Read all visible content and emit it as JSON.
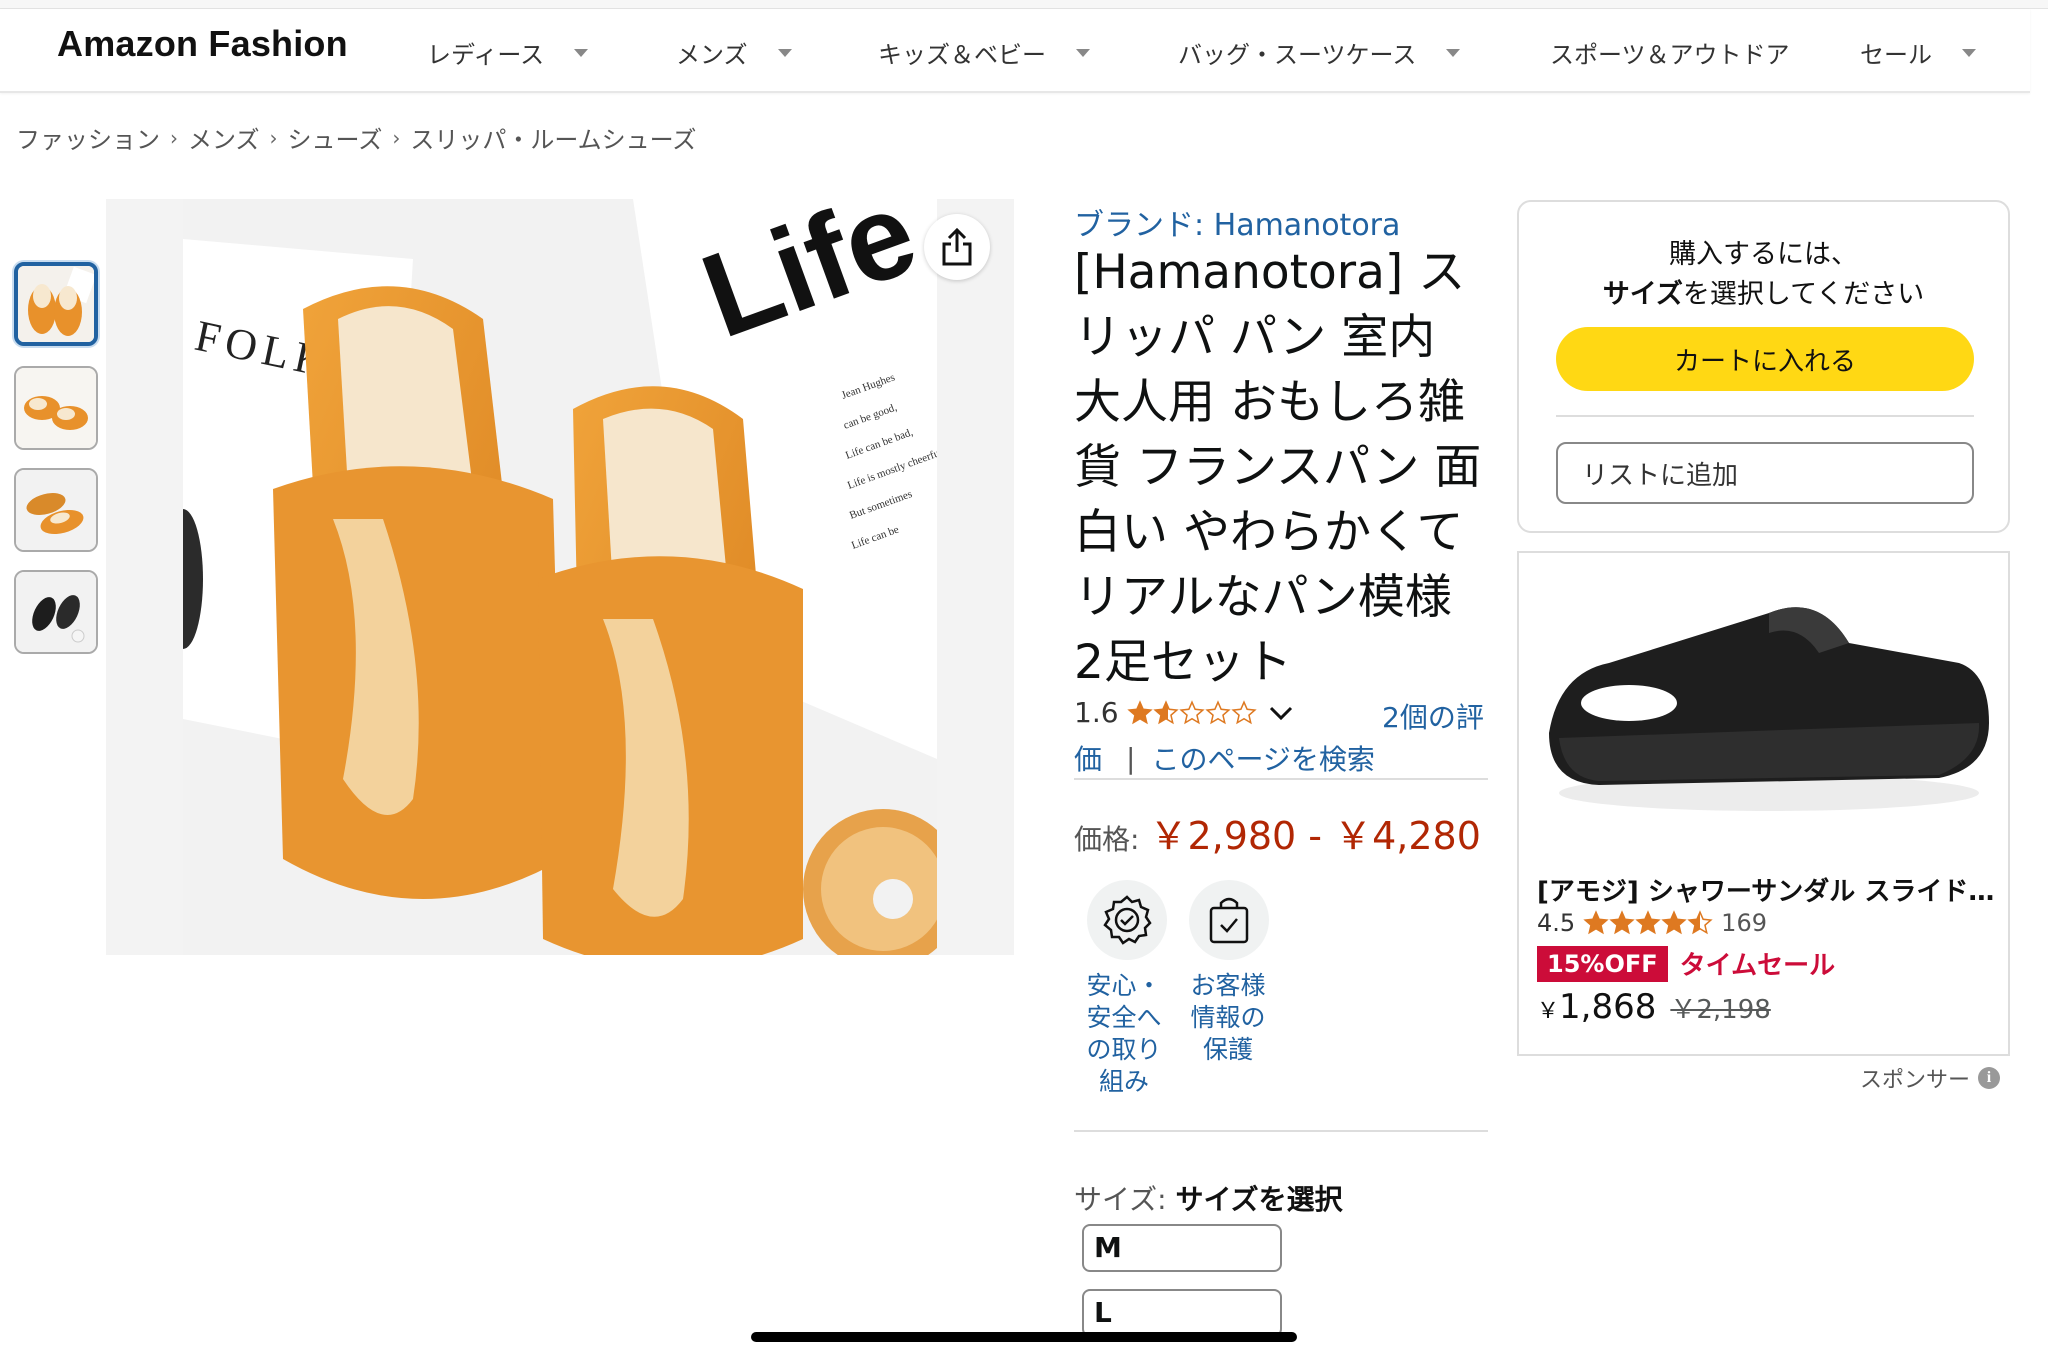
{
  "nav": {
    "logo": "Amazon Fashion",
    "items": [
      {
        "label": "レディース"
      },
      {
        "label": "メンズ"
      },
      {
        "label": "キッズ＆ベビー"
      },
      {
        "label": "バッグ・スーツケース"
      },
      {
        "label": "スポーツ＆アウトドア"
      },
      {
        "label": "セール"
      }
    ]
  },
  "breadcrumb": [
    "ファッション",
    "メンズ",
    "シューズ",
    "スリッパ・ルームシューズ"
  ],
  "gallery": {
    "thumbnails": [
      "bread-slippers-top",
      "bread-slippers-angle",
      "bread-slippers-side",
      "black-slippers"
    ],
    "selected_index": 0
  },
  "product": {
    "brand": "ブランド: Hamanotora",
    "title": "[Hamanotora] スリッパ パン 室内 大人用 おもしろ雑貨 フランスパン 面白い やわらかくて リアルなパン模様 2足セット",
    "rating": "1.6",
    "rating_value": 1.6,
    "review_count_part1": "2個の評",
    "review_count_part2": "価",
    "search_page": "このページを検索",
    "price_label": "価格:",
    "price": "￥2,980 - ￥4,280",
    "badges": [
      {
        "icon": "safety-seal-icon",
        "line1": "安心・",
        "line2": "安全へ",
        "line3": "の取り",
        "line4": "組み"
      },
      {
        "icon": "shopping-bag-check-icon",
        "line1": "お客様",
        "line2": "情報の",
        "line3": "保護"
      }
    ],
    "size_label": "サイズ:",
    "size_value": "サイズを選択",
    "sizes": [
      "M",
      "L"
    ]
  },
  "buybox": {
    "line1": "購入するには、",
    "line2_bold": "サイズ",
    "line2_rest": "を選択してください",
    "cart_button": "カートに入れる",
    "list_button": "リストに追加",
    "cart_color": "#ffd814"
  },
  "sponsored_ad": {
    "title": "[アモジ] シャワーサンダル スライドサンダル",
    "rating": "4.5",
    "rating_value": 4.5,
    "review_count": "169",
    "deal_badge": "15%OFF",
    "deal_text": "タイムセール",
    "currency": "￥",
    "price": "1,868",
    "list_price": "￥2,198",
    "sponsor_label": "スポンサー",
    "deal_color": "#cc0c39"
  },
  "colors": {
    "link": "#2162a1",
    "price": "#b12704",
    "star": "#de7921"
  }
}
